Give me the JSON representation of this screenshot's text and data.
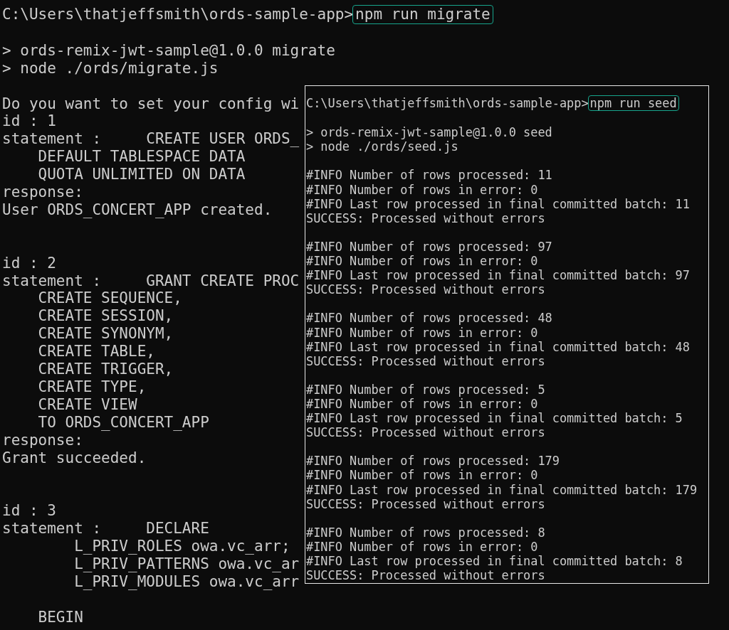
{
  "main_terminal": {
    "prompt": "C:\\Users\\thatjeffsmith\\ords-sample-app>",
    "command": {
      "text": "npm run migrate",
      "highlighted": true
    },
    "blocks": [
      {
        "kind": "output",
        "lines": [
          "> ords-remix-jwt-sample@1.0.0 migrate",
          "> node ./ords/migrate.js"
        ]
      },
      {
        "kind": "record",
        "lines": [
          "Do you want to set your config wi",
          "id : 1",
          "statement :     CREATE USER ORDS_",
          "    DEFAULT TABLESPACE DATA",
          "    QUOTA UNLIMITED ON DATA",
          "response:",
          "User ORDS_CONCERT_APP created."
        ]
      },
      {
        "kind": "record",
        "lines": [
          "id : 2",
          "statement :     GRANT CREATE PROC",
          "    CREATE SEQUENCE,",
          "    CREATE SESSION,",
          "    CREATE SYNONYM,",
          "    CREATE TABLE,",
          "    CREATE TRIGGER,",
          "    CREATE TYPE,",
          "    CREATE VIEW",
          "    TO ORDS_CONCERT_APP",
          "response:",
          "Grant succeeded."
        ]
      },
      {
        "kind": "output",
        "lines": [
          "id : 3",
          "statement :     DECLARE",
          "        L_PRIV_ROLES owa.vc_arr;",
          "        L_PRIV_PATTERNS owa.vc_ar",
          "        L_PRIV_MODULES owa.vc_arr"
        ]
      },
      {
        "lines": [
          "    BEGIN"
        ]
      }
    ]
  },
  "seed_terminal": {
    "prompt": "C:\\Users\\thatjeffsmith\\ords-sample-app>",
    "command": {
      "text": "npm run seed",
      "highlighted": true
    },
    "blocks": [
      {
        "lines": [
          "> ords-remix-jwt-sample@1.0.0 seed",
          "> node ./ords/seed.js"
        ]
      },
      {
        "lines": [
          "#INFO Number of rows processed: 11",
          "#INFO Number of rows in error: 0",
          "#INFO Last row processed in final committed batch: 11",
          "SUCCESS: Processed without errors"
        ]
      },
      {
        "lines": [
          "#INFO Number of rows processed: 97",
          "#INFO Number of rows in error: 0",
          "#INFO Last row processed in final committed batch: 97",
          "SUCCESS: Processed without errors"
        ]
      },
      {
        "lines": [
          "#INFO Number of rows processed: 48",
          "#INFO Number of rows in error: 0",
          "#INFO Last row processed in final committed batch: 48",
          "SUCCESS: Processed without errors"
        ]
      },
      {
        "lines": [
          "#INFO Number of rows processed: 5",
          "#INFO Number of rows in error: 0",
          "#INFO Last row processed in final committed batch: 5",
          "SUCCESS: Processed without errors"
        ]
      },
      {
        "lines": [
          "#INFO Number of rows processed: 179",
          "#INFO Number of rows in error: 0",
          "#INFO Last row processed in final committed batch: 179",
          "SUCCESS: Processed without errors"
        ]
      },
      {
        "lines": [
          "#INFO Number of rows processed: 8",
          "#INFO Number of rows in error: 0",
          "#INFO Last row processed in final committed batch: 8",
          "SUCCESS: Processed without errors"
        ]
      }
    ]
  }
}
